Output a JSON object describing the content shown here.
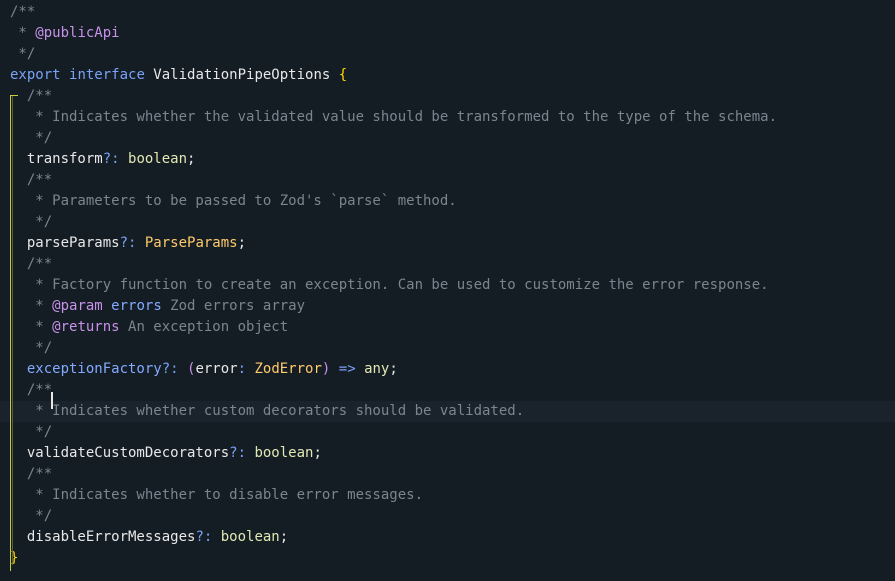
{
  "editor": {
    "lines": [
      [
        {
          "t": "/**",
          "c": "cm"
        }
      ],
      [
        {
          "t": " * ",
          "c": "cm"
        },
        {
          "t": "@publicApi",
          "c": "cmd"
        }
      ],
      [
        {
          "t": " */",
          "c": "cm"
        }
      ],
      [
        {
          "t": "export",
          "c": "kw"
        },
        {
          "t": " ",
          "c": "pu"
        },
        {
          "t": "interface",
          "c": "kw"
        },
        {
          "t": " ValidationPipeOptions ",
          "c": "pu"
        },
        {
          "t": "{",
          "c": "br"
        }
      ],
      [
        {
          "t": "  /**",
          "c": "cm"
        }
      ],
      [
        {
          "t": "   * Indicates whether the validated value should be transformed to the type of the schema.",
          "c": "cm"
        }
      ],
      [
        {
          "t": "   */",
          "c": "cm"
        }
      ],
      [
        {
          "t": "  transform",
          "c": "pu"
        },
        {
          "t": "?: ",
          "c": "kw"
        },
        {
          "t": "boolean",
          "c": "typ"
        },
        {
          "t": ";",
          "c": "pu"
        }
      ],
      [
        {
          "t": "  /**",
          "c": "cm"
        }
      ],
      [
        {
          "t": "   * Parameters to be passed to Zod's `parse` method.",
          "c": "cm"
        }
      ],
      [
        {
          "t": "   */",
          "c": "cm"
        }
      ],
      [
        {
          "t": "  parseParams",
          "c": "pu"
        },
        {
          "t": "?: ",
          "c": "kw"
        },
        {
          "t": "ParseParams",
          "c": "cls"
        },
        {
          "t": ";",
          "c": "pu"
        }
      ],
      [
        {
          "t": "  /**",
          "c": "cm"
        }
      ],
      [
        {
          "t": "   * Factory function to create an exception. Can be used to customize the error response.",
          "c": "cm"
        }
      ],
      [
        {
          "t": "   * ",
          "c": "cm"
        },
        {
          "t": "@param",
          "c": "cmd"
        },
        {
          "t": " ",
          "c": "cm"
        },
        {
          "t": "errors",
          "c": "pv"
        },
        {
          "t": " Zod errors array",
          "c": "cm"
        }
      ],
      [
        {
          "t": "   * ",
          "c": "cm"
        },
        {
          "t": "@returns",
          "c": "cmd"
        },
        {
          "t": " An exception object",
          "c": "cm"
        }
      ],
      [
        {
          "t": "   */",
          "c": "cm"
        }
      ],
      [
        {
          "t": "  exceptionFactory",
          "c": "fn"
        },
        {
          "t": "?: ",
          "c": "kw"
        },
        {
          "t": "(",
          "c": "cmd"
        },
        {
          "t": "error",
          "c": "pu"
        },
        {
          "t": ": ",
          "c": "kw"
        },
        {
          "t": "ZodError",
          "c": "cls"
        },
        {
          "t": ")",
          "c": "cmd"
        },
        {
          "t": " => ",
          "c": "kw"
        },
        {
          "t": "any",
          "c": "typ"
        },
        {
          "t": ";",
          "c": "pu"
        }
      ],
      [
        {
          "t": "  /**",
          "c": "cm"
        }
      ],
      [
        {
          "t": "   * Indicates whether custom decorators should be validated.",
          "c": "cm"
        }
      ],
      [
        {
          "t": "   */",
          "c": "cm"
        }
      ],
      [
        {
          "t": "  validateCustomDecorators",
          "c": "pu"
        },
        {
          "t": "?: ",
          "c": "kw"
        },
        {
          "t": "boolean",
          "c": "typ"
        },
        {
          "t": ";",
          "c": "pu"
        }
      ],
      [
        {
          "t": "  /**",
          "c": "cm"
        }
      ],
      [
        {
          "t": "   * Indicates whether to disable error messages.",
          "c": "cm"
        }
      ],
      [
        {
          "t": "   */",
          "c": "cm"
        }
      ],
      [
        {
          "t": "  disableErrorMessages",
          "c": "pu"
        },
        {
          "t": "?: ",
          "c": "kw"
        },
        {
          "t": "boolean",
          "c": "typ"
        },
        {
          "t": ";",
          "c": "pu"
        }
      ],
      [
        {
          "t": "}",
          "c": "br"
        }
      ]
    ],
    "current_line": 19
  },
  "colors": {
    "background": "#141c24",
    "comment": "#7c858f",
    "keyword": "#7aa2f7",
    "type": "#e2e8b4",
    "class": "#ffcb6b",
    "bracket": "#ffd700"
  }
}
